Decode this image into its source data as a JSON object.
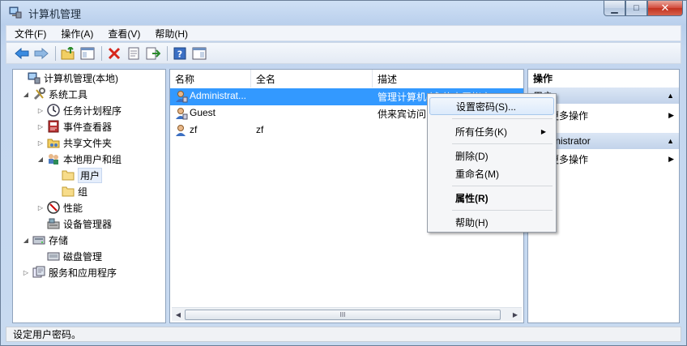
{
  "window": {
    "title": "计算机管理",
    "minimize_glyph": "▁",
    "maximize_glyph": "□",
    "close_glyph": "✕"
  },
  "menubar": {
    "items": [
      "文件(F)",
      "操作(A)",
      "查看(V)",
      "帮助(H)"
    ]
  },
  "toolbar": {
    "icons": [
      "back-arrow-icon",
      "forward-arrow-icon",
      "up-folder-icon",
      "console-tree-icon",
      "delete-icon",
      "properties-icon",
      "export-icon",
      "help-icon",
      "show-hide-icon"
    ]
  },
  "tree": {
    "items": [
      {
        "label": "计算机管理(本地)",
        "arrow": "",
        "level": 0
      },
      {
        "label": "系统工具",
        "arrow": "◢",
        "level": 1
      },
      {
        "label": "任务计划程序",
        "arrow": "▷",
        "level": 2
      },
      {
        "label": "事件查看器",
        "arrow": "▷",
        "level": 2
      },
      {
        "label": "共享文件夹",
        "arrow": "▷",
        "level": 2
      },
      {
        "label": "本地用户和组",
        "arrow": "◢",
        "level": 2
      },
      {
        "label": "用户",
        "arrow": "",
        "level": 3,
        "selected": true
      },
      {
        "label": "组",
        "arrow": "",
        "level": 3
      },
      {
        "label": "性能",
        "arrow": "▷",
        "level": 2
      },
      {
        "label": "设备管理器",
        "arrow": "",
        "level": 2
      },
      {
        "label": "存储",
        "arrow": "◢",
        "level": 1
      },
      {
        "label": "磁盘管理",
        "arrow": "",
        "level": 2
      },
      {
        "label": "服务和应用程序",
        "arrow": "▷",
        "level": 1
      }
    ]
  },
  "list": {
    "columns": [
      "名称",
      "全名",
      "描述"
    ],
    "rows": [
      {
        "name": "Administrat...",
        "fullname": "",
        "description": "管理计算机(域)的内置帐户",
        "selected": true
      },
      {
        "name": "Guest",
        "fullname": "",
        "description": "供来宾访问",
        "selected": false
      },
      {
        "name": "zf",
        "fullname": "zf",
        "description": "",
        "selected": false
      }
    ],
    "scroll_grip": "III"
  },
  "actions": {
    "title": "操作",
    "group1": "用户",
    "group1_more": "更多操作",
    "group2": "Administrator",
    "group2_more": "更多操作"
  },
  "context_menu": {
    "items": {
      "set_password": "设置密码(S)...",
      "all_tasks": "所有任务(K)",
      "delete": "删除(D)",
      "rename": "重命名(M)",
      "properties": "属性(R)",
      "help": "帮助(H)"
    }
  },
  "status": {
    "text": "设定用户密码。"
  }
}
